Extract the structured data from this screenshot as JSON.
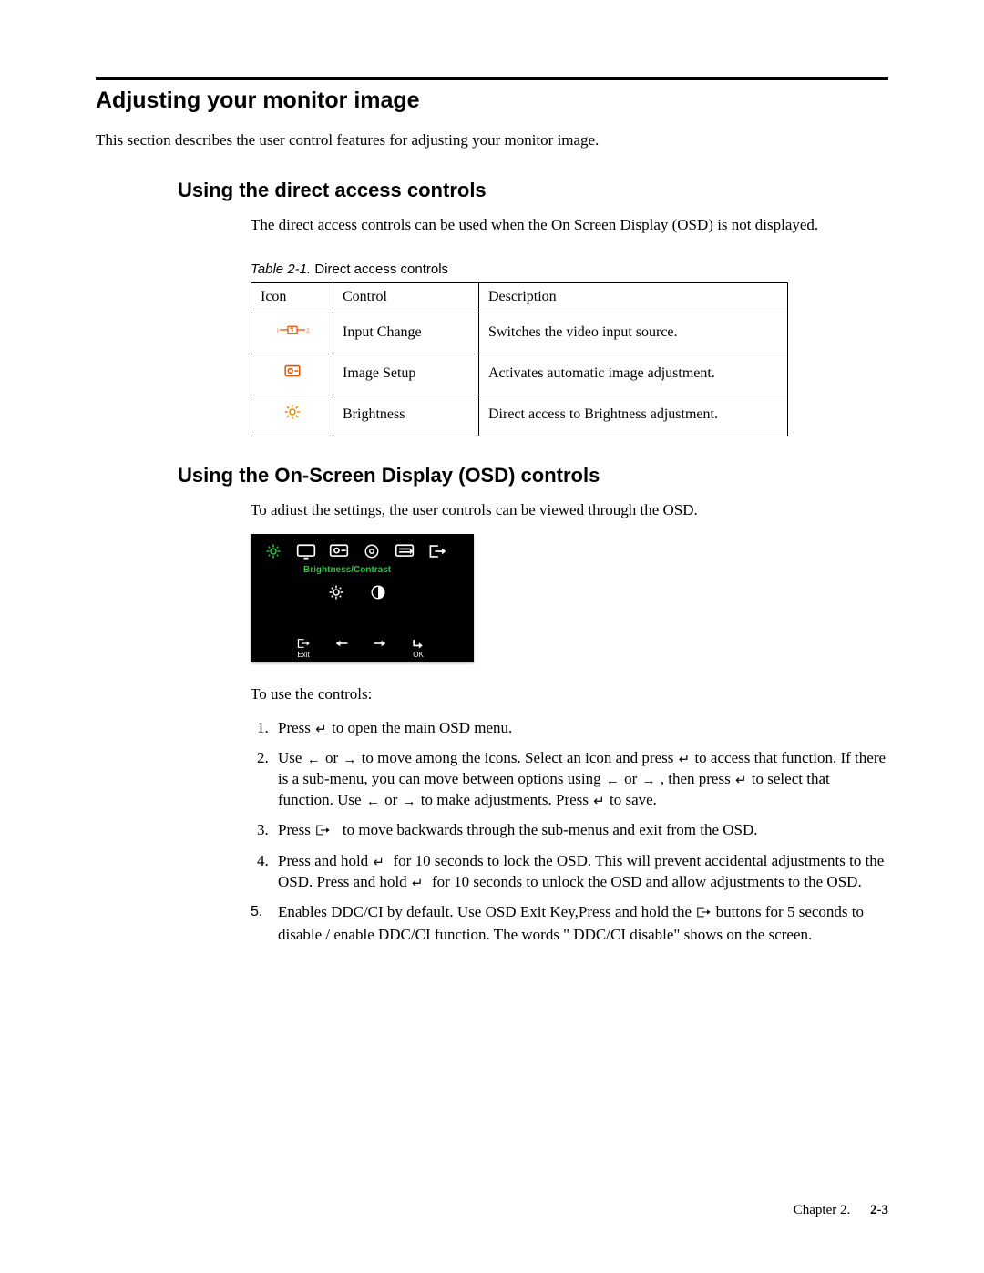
{
  "h1": "Adjusting your monitor image",
  "intro": "This section describes the user control features for adjusting your monitor image.",
  "h2a": "Using the direct access controls",
  "p2a": "The direct access controls can be used when the On Screen Display (OSD) is not displayed.",
  "tableCaptionItalic": "Table 2-1.",
  "tableCaptionRest": " Direct access controls",
  "table": {
    "headers": {
      "c1": "Icon",
      "c2": "Control",
      "c3": "Description"
    },
    "rows": [
      {
        "control": "Input Change",
        "desc": "Switches the video input source."
      },
      {
        "control": "Image Setup",
        "desc": "Activates automatic image adjustment."
      },
      {
        "control": "Brightness",
        "desc": "Direct access to Brightness adjustment."
      }
    ]
  },
  "h2b": "Using the On-Screen Display (OSD) controls",
  "p2b": "To adiust the settings, the user controls can be viewed through the OSD.",
  "osd": {
    "label": "Brightness/Contrast",
    "exit": "Exit",
    "ok": "OK"
  },
  "stepsIntro": "To use the controls:",
  "steps": {
    "s1a": "Press ",
    "s1b": " to open the main OSD menu.",
    "s2a": "Use ",
    "s2b": " or ",
    "s2c": " to move among the icons. Select an icon and press ",
    "s2d": " to access that function. If there is a sub-menu, you can move between options using ",
    "s2e": " or ",
    "s2f": " , then press ",
    "s2g": " to select that function. Use ",
    "s2h": " or ",
    "s2i": " to make adjustments. Press ",
    "s2j": " to save.",
    "s3a": "Press ",
    "s3b": " to move backwards through the sub-menus and exit from the OSD.",
    "s4a": "Press and hold ",
    "s4b": " for 10 seconds to lock the OSD. This will prevent accidental adjustments to the OSD. Press and hold ",
    "s4c": " for 10  seconds to unlock the OSD and allow adjustments to the OSD.",
    "s5num": "5.",
    "s5a": "Enables DDC/CI by default. Use OSD Exit Key,Press and hold the ",
    "s5b": " buttons  for 5 seconds to disable / enable DDC/CI function. The words \" DDC/CI disable\" shows on the screen."
  },
  "footer": {
    "chapter": "Chapter 2.",
    "page": "2-3"
  }
}
